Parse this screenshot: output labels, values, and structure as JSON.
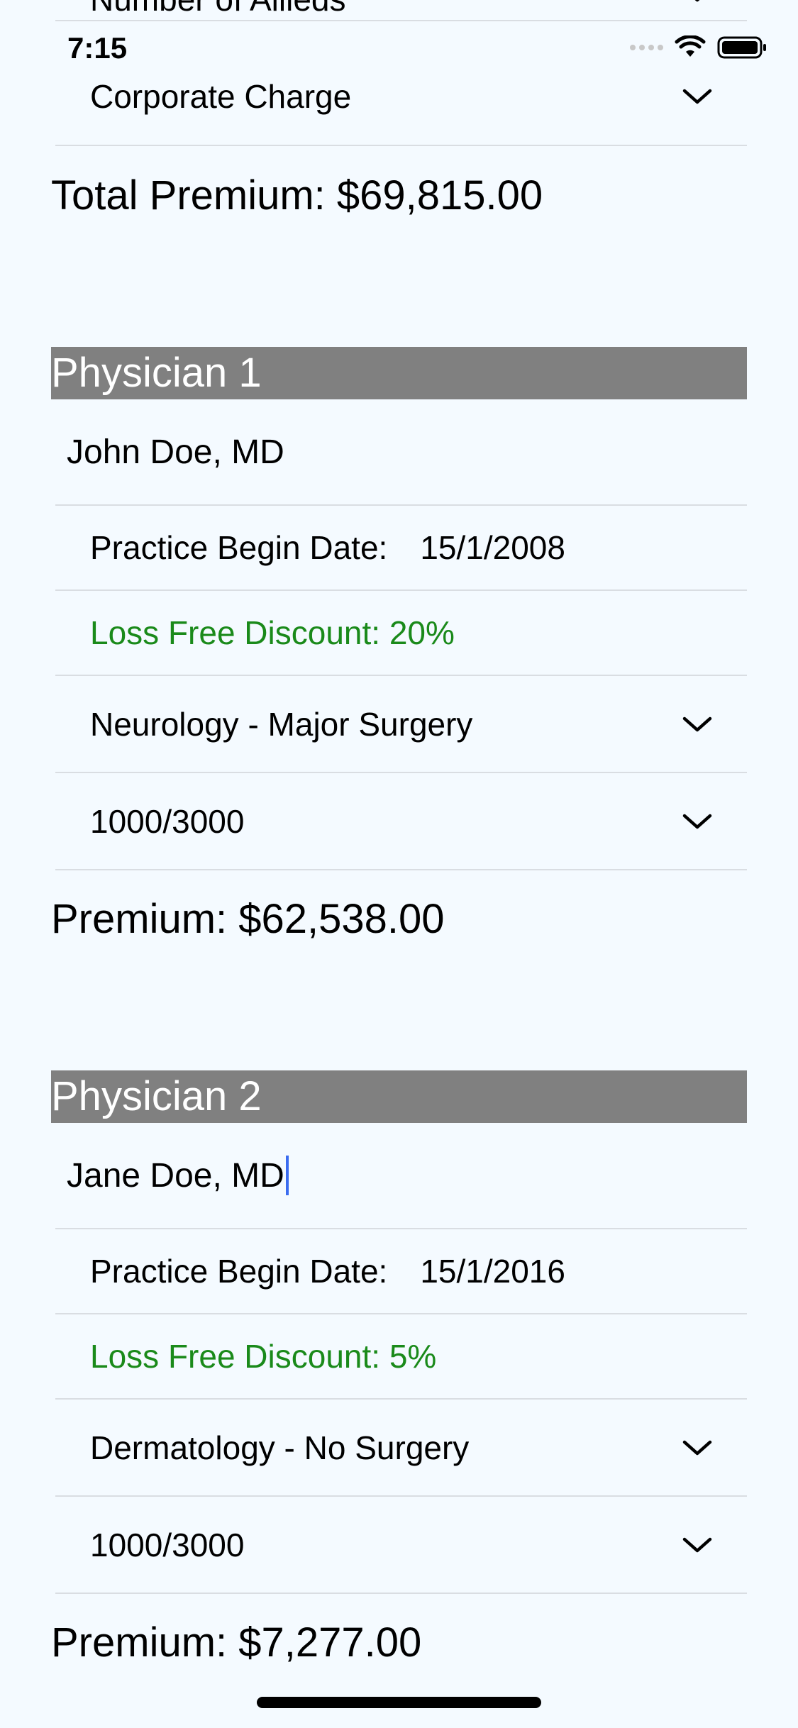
{
  "status_bar": {
    "time": "7:15"
  },
  "top_section": {
    "clipped_item_label": "Number of Allieds",
    "corporate_charge_label": "Corporate Charge",
    "total_premium": "Total Premium: $69,815.00"
  },
  "physicians": [
    {
      "header": "Physician 1",
      "name": "John Doe, MD",
      "practice_begin_label": "Practice Begin Date:",
      "practice_begin_value": "15/1/2008",
      "discount": "Loss Free Discount: 20%",
      "specialty": "Neurology - Major Surgery",
      "limits": "1000/3000",
      "premium": "Premium: $62,538.00"
    },
    {
      "header": "Physician 2",
      "name": "Jane Doe, MD",
      "practice_begin_label": "Practice Begin Date:",
      "practice_begin_value": "15/1/2016",
      "discount": "Loss Free Discount: 5%",
      "specialty": "Dermatology - No Surgery",
      "limits": "1000/3000",
      "premium": "Premium: $7,277.00"
    }
  ],
  "colors": {
    "background": "#f4faff",
    "header_bg": "#808080",
    "discount_text": "#1a8a1a",
    "cursor": "#3a6cf0",
    "divider": "#d9dde2"
  },
  "icons": {
    "dropdown": "chevron-down-icon",
    "wifi": "wifi-icon",
    "battery": "battery-icon",
    "signal": "cellular-signal-icon"
  }
}
